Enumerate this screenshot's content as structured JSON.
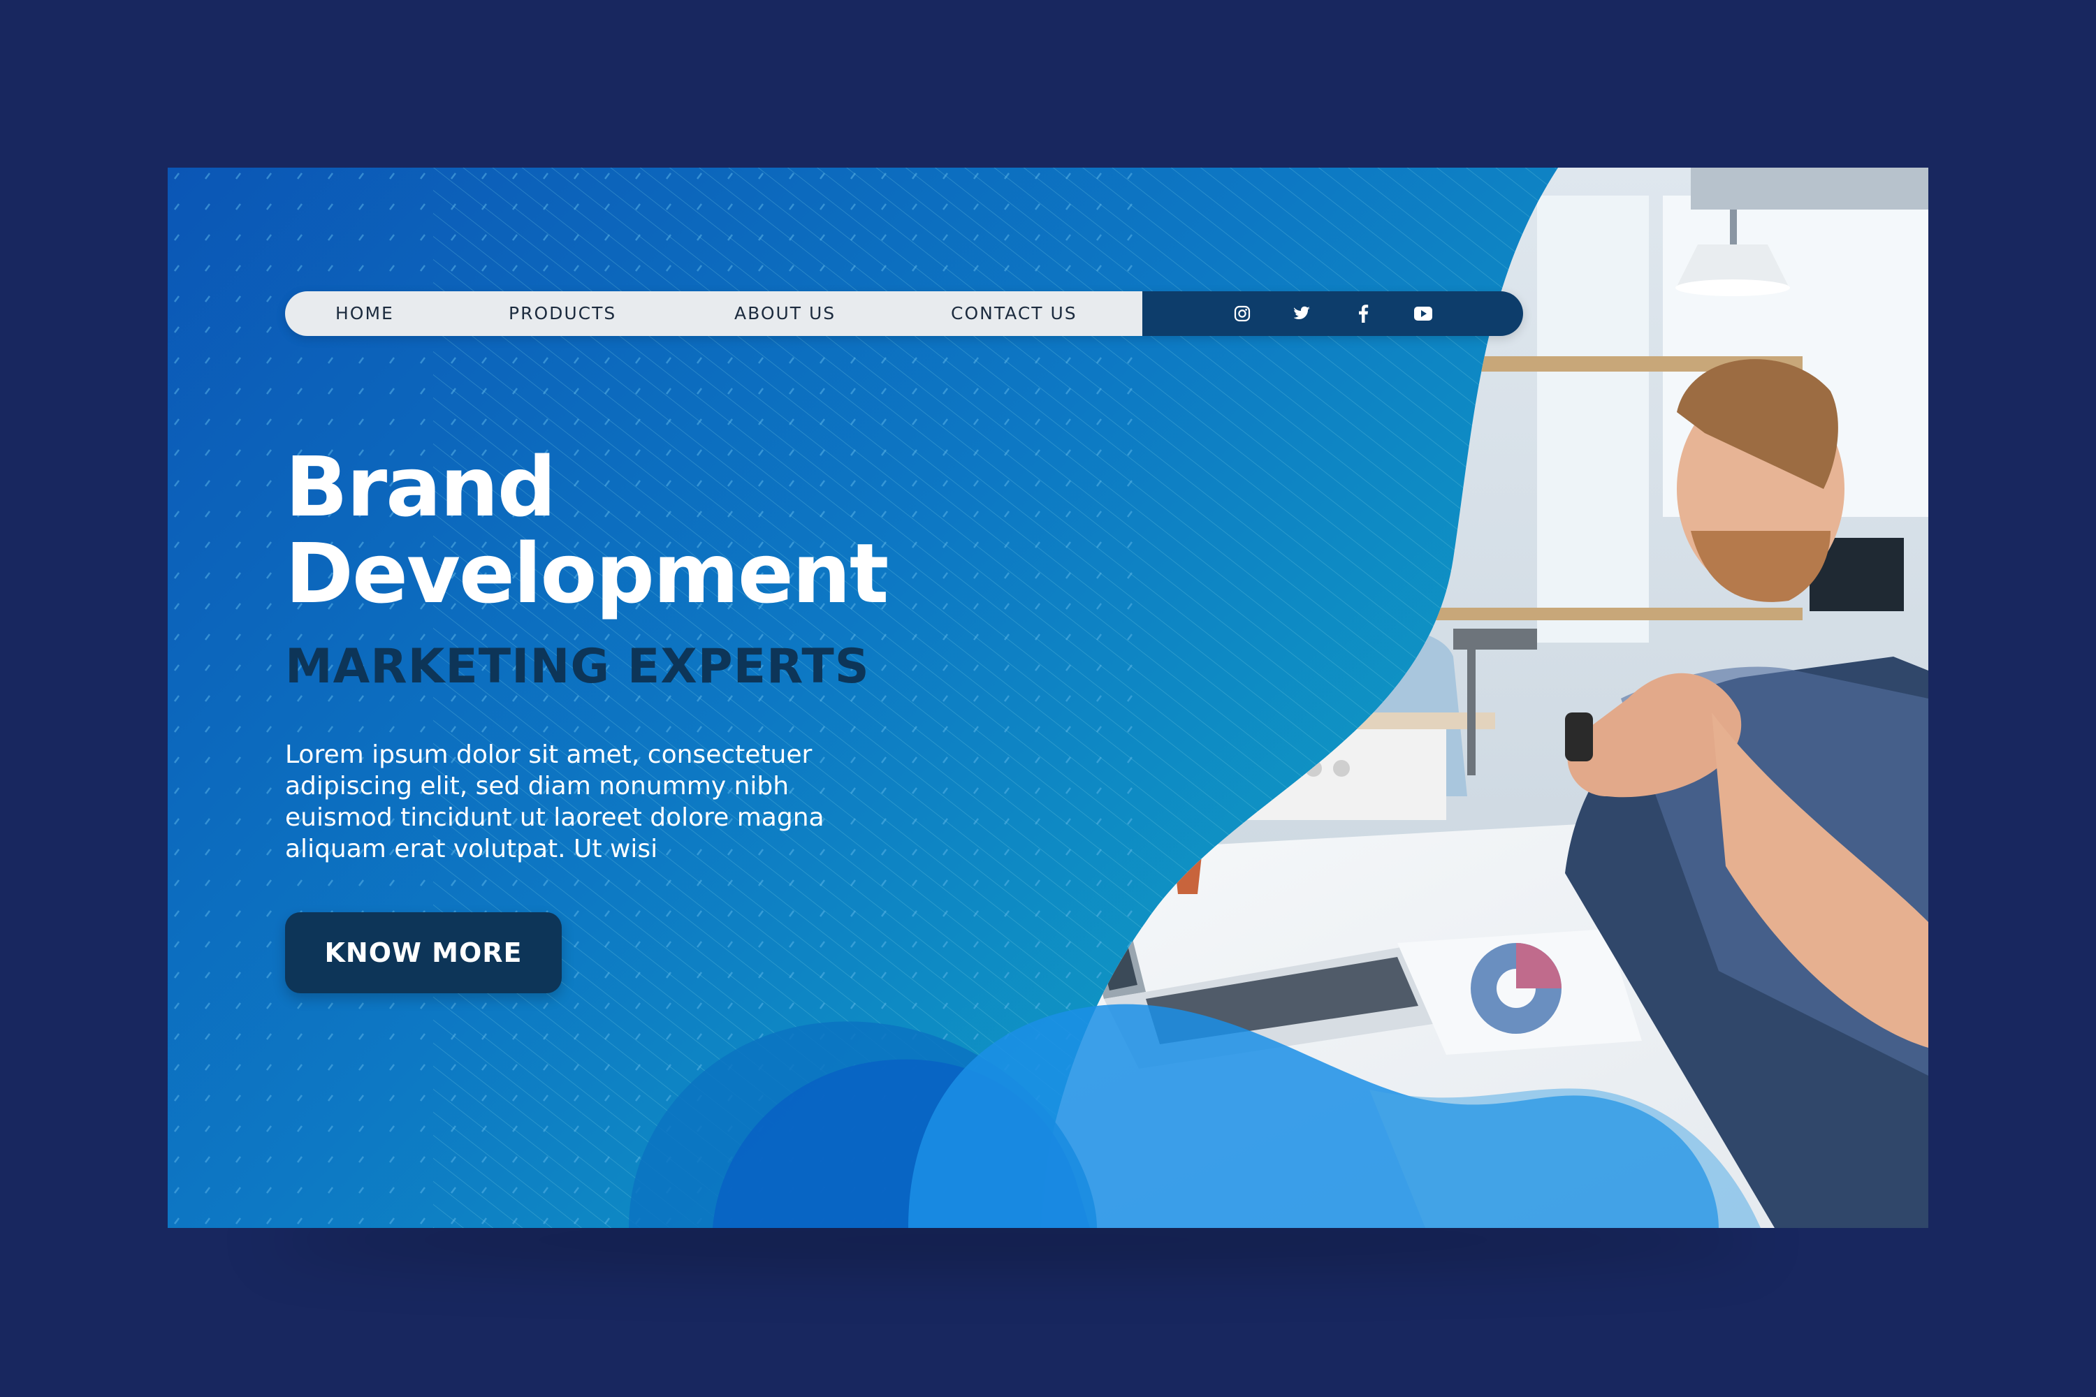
{
  "nav": {
    "items": [
      {
        "label": "HOME"
      },
      {
        "label": "PRODUCTS"
      },
      {
        "label": "ABOUT US"
      },
      {
        "label": "CONTACT US"
      }
    ],
    "social": [
      "instagram-icon",
      "twitter-icon",
      "facebook-icon",
      "youtube-icon"
    ]
  },
  "hero": {
    "title_line1": "Brand",
    "title_line2": "Development",
    "subtitle": "MARKETING EXPERTS",
    "body_lines": [
      "Lorem ipsum dolor sit amet, consectetuer",
      "adipiscing elit, sed diam nonummy nibh",
      "euismod tincidunt ut laoreet dolore magna",
      "aliquam erat volutpat. Ut wisi"
    ],
    "cta_label": "KNOW MORE"
  },
  "colors": {
    "page_background": "#18275f",
    "nav_light": "#e8ebee",
    "nav_dark": "#0d3d6b",
    "accent_dark": "#0d3558",
    "gradient_start": "#0b56b5",
    "gradient_end": "#12b8c6"
  }
}
